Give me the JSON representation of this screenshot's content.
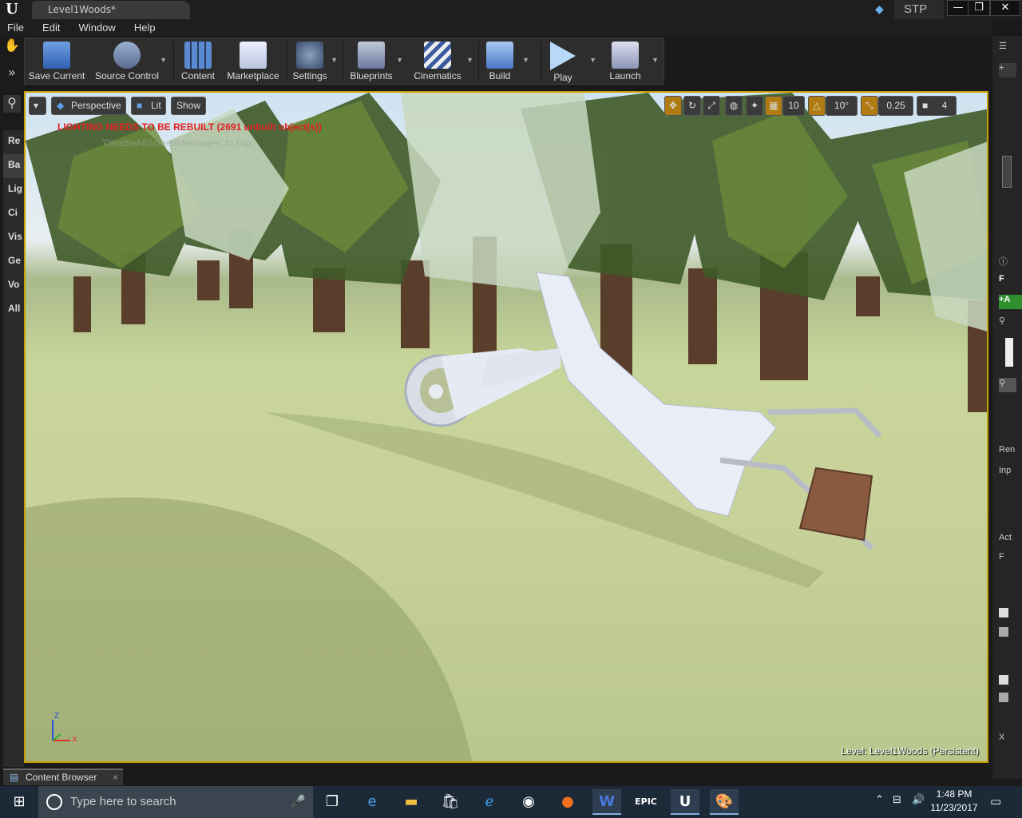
{
  "window": {
    "tab_title": "Level1Woods*",
    "project_label": "STP",
    "controls": {
      "minimize": "—",
      "restore": "❐",
      "close": "✕"
    }
  },
  "menu": [
    "File",
    "Edit",
    "Window",
    "Help"
  ],
  "toolbar": {
    "items": [
      {
        "label": "Save Current",
        "icon": "save-icon"
      },
      {
        "label": "Source Control",
        "icon": "source-control-icon"
      },
      {
        "label": "Content",
        "icon": "content-icon"
      },
      {
        "label": "Marketplace",
        "icon": "marketplace-icon"
      },
      {
        "label": "Settings",
        "icon": "settings-icon"
      },
      {
        "label": "Blueprints",
        "icon": "blueprints-icon"
      },
      {
        "label": "Cinematics",
        "icon": "cinematics-icon"
      },
      {
        "label": "Build",
        "icon": "build-icon"
      },
      {
        "label": "Play",
        "icon": "play-icon"
      },
      {
        "label": "Launch",
        "icon": "launch-icon"
      }
    ]
  },
  "left_tabs": [
    "Re",
    "Ba",
    "Lig",
    "Ci",
    "Vis",
    "Ge",
    "Vo",
    "All"
  ],
  "viewport": {
    "perspective_label": "Perspective",
    "lit_label": "Lit",
    "show_label": "Show",
    "warning": "LIGHTING NEEDS TO BE REBUILT (2691 unbuilt object(s))",
    "message_hint": "'DisableAllScreenMessages' to sup",
    "grid_snap": "10",
    "rotation_snap": "10°",
    "scale_snap": "0.25",
    "camera_speed": "4",
    "level_info": "Level:  Level1Woods (Persistent)",
    "axis": {
      "z": "Z",
      "x": "X"
    }
  },
  "right_panel": {
    "items": [
      "F",
      "+A",
      "Ren",
      "Inp",
      "Act",
      "F",
      "X"
    ]
  },
  "content_browser": {
    "tab_label": "Content Browser",
    "close": "×"
  },
  "taskbar": {
    "search_placeholder": "Type here to search",
    "time": "1:48 PM",
    "date": "11/23/2017",
    "apps": [
      "task-view-icon",
      "edge-icon",
      "file-explorer-icon",
      "store-icon",
      "ie-icon",
      "steam-icon",
      "firefox-icon",
      "word-icon",
      "epic-games-icon",
      "unreal-icon",
      "paint-icon"
    ]
  },
  "colors": {
    "accent_border": "#c8a000",
    "warning_text": "#e02020",
    "snap_active": "#b07b10"
  }
}
